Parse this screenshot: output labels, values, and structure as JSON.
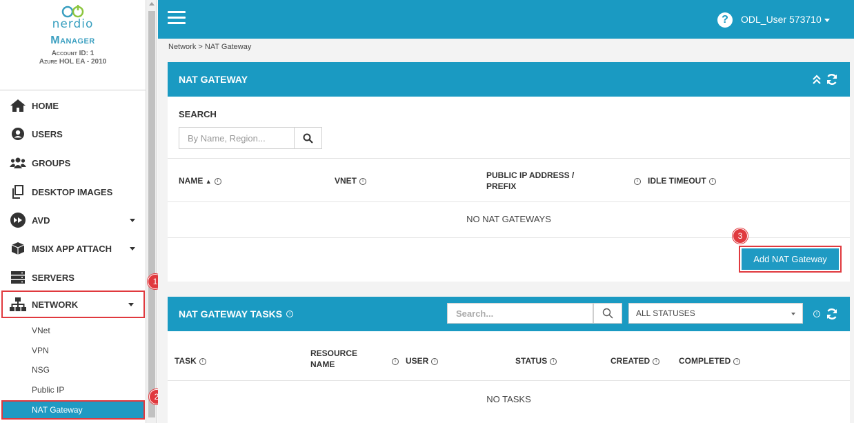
{
  "app": {
    "logo_word": "nerdio",
    "product": "Manager",
    "account": "Account ID: 1",
    "org": "Azure HOL EA - 2010"
  },
  "sidebar": {
    "items": [
      {
        "label": "HOME",
        "icon": "home-icon"
      },
      {
        "label": "USERS",
        "icon": "user-icon"
      },
      {
        "label": "GROUPS",
        "icon": "users-group-icon"
      },
      {
        "label": "DESKTOP IMAGES",
        "icon": "copy-icon"
      },
      {
        "label": "AVD",
        "icon": "avd-icon"
      },
      {
        "label": "MSIX APP ATTACH",
        "icon": "package-icon"
      },
      {
        "label": "SERVERS",
        "icon": "server-icon"
      },
      {
        "label": "NETWORK",
        "icon": "network-icon"
      }
    ],
    "network_sub": [
      "VNet",
      "VPN",
      "NSG",
      "Public IP",
      "NAT Gateway"
    ]
  },
  "callouts": {
    "one": "1",
    "two": "2",
    "three": "3"
  },
  "topbar": {
    "help": "?",
    "user": "ODL_User 573710"
  },
  "breadcrumb": "Network > NAT Gateway",
  "nat_panel": {
    "title": "NAT GATEWAY",
    "search_label": "SEARCH",
    "search_placeholder": "By Name, Region...",
    "columns": {
      "name": "NAME",
      "vnet": "VNET",
      "public_ip_line1": "PUBLIC IP ADDRESS /",
      "public_ip_line2": "PREFIX",
      "idle_timeout": "IDLE TIMEOUT"
    },
    "empty": "NO NAT GATEWAYS",
    "add_button": "Add NAT Gateway"
  },
  "tasks_panel": {
    "title": "NAT GATEWAY TASKS",
    "search_placeholder": "Search...",
    "status_select": "ALL STATUSES",
    "columns": {
      "task": "TASK",
      "resource_line1": "RESOURCE",
      "resource_line2": "NAME",
      "user": "USER",
      "status": "STATUS",
      "created": "CREATED",
      "completed": "COMPLETED"
    },
    "empty": "NO TASKS"
  },
  "colors": {
    "accent": "#1a9ac2",
    "highlight": "#e0393e"
  }
}
